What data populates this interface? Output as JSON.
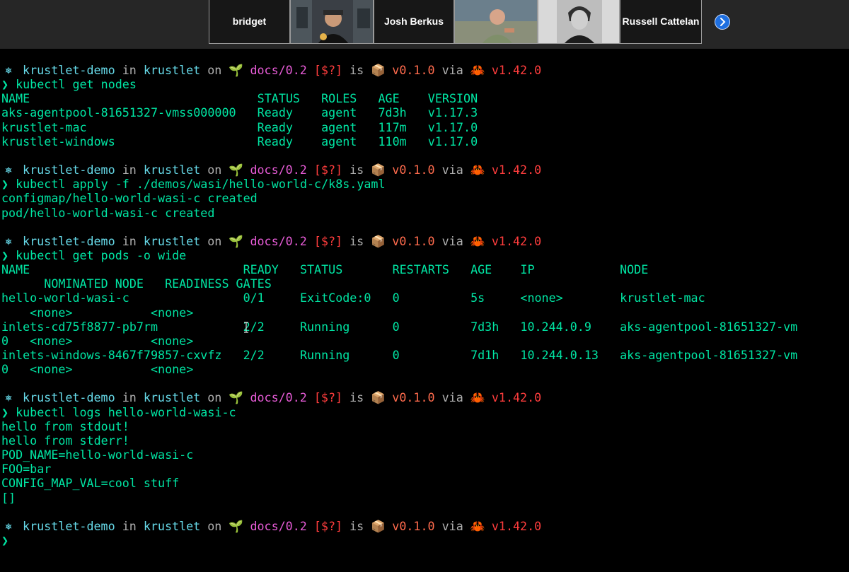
{
  "participants": {
    "tiles": [
      {
        "type": "name",
        "label": "bridget"
      },
      {
        "type": "video",
        "label": "participant video"
      },
      {
        "type": "name",
        "label": "Josh Berkus"
      },
      {
        "type": "video",
        "label": "participant video"
      },
      {
        "type": "video",
        "label": "participant video"
      },
      {
        "type": "name",
        "label": "Russell Cattelan"
      }
    ],
    "next_icon": "chevron-right-icon"
  },
  "colors": {
    "green": "#00e5a3",
    "teal": "#66d9e8",
    "pink": "#e65bd6",
    "red": "#ff3d3d",
    "yellow": "#ffd84a",
    "orange": "#ff6b4d"
  },
  "prompt": {
    "gear": "⎈",
    "dir": "krustlet-demo",
    "in": "in",
    "repo": "krustlet",
    "on": "on",
    "branch_icon": "🌱",
    "branch": "docs/0.2",
    "status": "[$?]",
    "is": "is",
    "pkg_icon": "📦",
    "pkg_version": "v0.1.0",
    "via": "via",
    "rust_icon": "🦀",
    "rust_version": "v1.42.0",
    "caret": "❯"
  },
  "blocks": [
    {
      "command": "kubectl get nodes",
      "output": [
        "NAME                                STATUS   ROLES   AGE    VERSION",
        "aks-agentpool-81651327-vmss000000   Ready    agent   7d3h   v1.17.3",
        "krustlet-mac                        Ready    agent   117m   v1.17.0",
        "krustlet-windows                    Ready    agent   110m   v1.17.0"
      ]
    },
    {
      "command": "kubectl apply -f ./demos/wasi/hello-world-c/k8s.yaml",
      "output": [
        "configmap/hello-world-wasi-c created",
        "pod/hello-world-wasi-c created"
      ]
    },
    {
      "command": "kubectl get pods -o wide",
      "output": [
        "NAME                              READY   STATUS       RESTARTS   AGE    IP            NODE",
        "      NOMINATED NODE   READINESS GATES",
        "hello-world-wasi-c                0/1     ExitCode:0   0          5s     <none>        krustlet-mac",
        "    <none>           <none>",
        "inlets-cd75f8877-pb7rm            2/2     Running      0          7d3h   10.244.0.9    aks-agentpool-81651327-vm",
        "0   <none>           <none>",
        "inlets-windows-8467f79857-cxvfz   2/2     Running      0          7d1h   10.244.0.13   aks-agentpool-81651327-vm",
        "0   <none>           <none>"
      ]
    },
    {
      "command": "kubectl logs hello-world-wasi-c",
      "output": [
        "hello from stdout!",
        "hello from stderr!",
        "POD_NAME=hello-world-wasi-c",
        "FOO=bar",
        "CONFIG_MAP_VAL=cool stuff",
        "[]"
      ]
    }
  ]
}
